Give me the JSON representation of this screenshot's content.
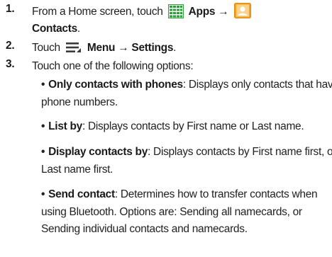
{
  "steps": [
    {
      "number": "1.",
      "line1_prefix": "From a Home screen, touch",
      "apps_label": "Apps",
      "arrow": "→",
      "contacts_label": "Contacts",
      "contacts_suffix": "."
    },
    {
      "number": "2.",
      "prefix": "Touch",
      "menu_label": "Menu",
      "arrow": "→",
      "settings_label": "Settings",
      "suffix": "."
    },
    {
      "number": "3.",
      "text": "Touch one of the following options:"
    }
  ],
  "options": [
    {
      "term": "Only contacts with phones",
      "line1": ": Displays only contacts that have",
      "line2": "phone numbers."
    },
    {
      "term": "List by",
      "line1": ": Displays contacts by First name or Last name."
    },
    {
      "term": "Display contacts by",
      "line1": ": Displays contacts by First name first, or",
      "line2": "Last name first."
    },
    {
      "term": "Send contact",
      "line1": ": Determines how to transfer contacts when",
      "line2": "using Bluetooth. Options are: Sending all namecards, or",
      "line3": "Sending individual contacts and namecards."
    }
  ],
  "icons": {
    "apps": "apps-grid-icon",
    "contacts": "contacts-icon",
    "menu": "menu-icon"
  },
  "colors": {
    "apps_icon": "#2e9e3a",
    "contacts_icon_bg": "#f4a020",
    "text": "#222222"
  }
}
